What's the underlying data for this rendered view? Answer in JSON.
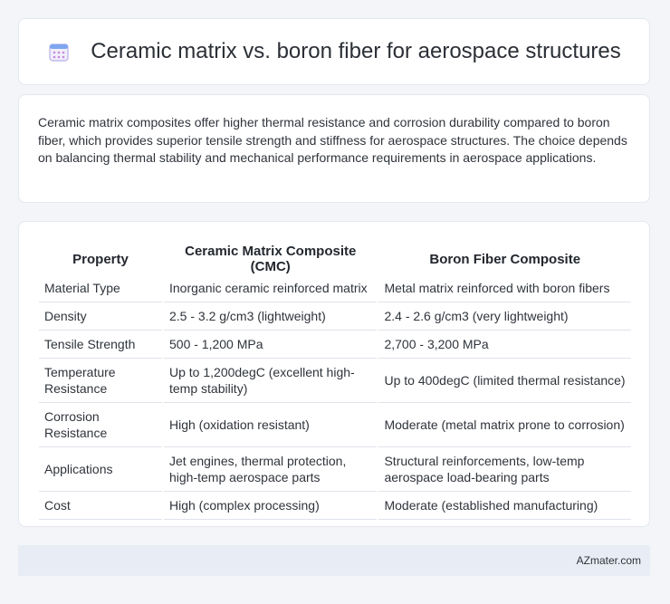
{
  "header": {
    "title": "Ceramic matrix vs. boron fiber for aerospace structures",
    "icon": "calendar-icon",
    "icon_color": "#8b7fd6"
  },
  "intro": {
    "text": "Ceramic matrix composites offer higher thermal resistance and corrosion durability compared to boron fiber, which provides superior tensile strength and stiffness for aerospace structures. The choice depends on balancing thermal stability and mechanical performance requirements in aerospace applications."
  },
  "table": {
    "headers": [
      "Property",
      "Ceramic Matrix Composite (CMC)",
      "Boron Fiber Composite"
    ],
    "rows": [
      [
        "Material Type",
        "Inorganic ceramic reinforced matrix",
        "Metal matrix reinforced with boron fibers"
      ],
      [
        "Density",
        "2.5 - 3.2 g/cm3 (lightweight)",
        "2.4 - 2.6 g/cm3 (very lightweight)"
      ],
      [
        "Tensile Strength",
        "500 - 1,200 MPa",
        "2,700 - 3,200 MPa"
      ],
      [
        "Temperature Resistance",
        "Up to 1,200degC (excellent high-temp stability)",
        "Up to 400degC (limited thermal resistance)"
      ],
      [
        "Corrosion Resistance",
        "High (oxidation resistant)",
        "Moderate (metal matrix prone to corrosion)"
      ],
      [
        "Applications",
        "Jet engines, thermal protection, high-temp aerospace parts",
        "Structural reinforcements, low-temp aerospace load-bearing parts"
      ],
      [
        "Cost",
        "High (complex processing)",
        "Moderate (established manufacturing)"
      ]
    ]
  },
  "footer": {
    "site": "AZmater.com"
  }
}
